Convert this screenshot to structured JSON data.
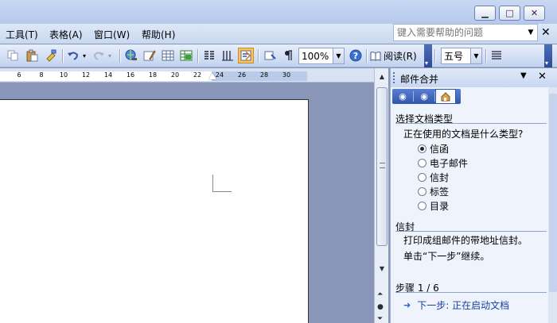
{
  "window": {
    "buttons": [
      "minimize",
      "maximize",
      "close"
    ]
  },
  "menubar": {
    "items": [
      "工具(T)",
      "表格(A)",
      "窗口(W)",
      "帮助(H)"
    ],
    "help_placeholder": "键入需要帮助的问题"
  },
  "toolbar": {
    "zoom_value": "100%",
    "read_label": "阅读(R)",
    "font_size_value": "五号"
  },
  "ruler": {
    "ticks": [
      "6",
      "8",
      "10",
      "12",
      "14",
      "16",
      "18",
      "20",
      "22",
      "24",
      "26",
      "28",
      "30"
    ]
  },
  "taskpane": {
    "title": "邮件合并",
    "section1_title": "选择文档类型",
    "question": "正在使用的文档是什么类型?",
    "options": [
      {
        "label": "信函",
        "selected": true
      },
      {
        "label": "电子邮件",
        "selected": false
      },
      {
        "label": "信封",
        "selected": false
      },
      {
        "label": "标签",
        "selected": false
      },
      {
        "label": "目录",
        "selected": false
      }
    ],
    "section2_title": "信封",
    "description": "打印成组邮件的带地址信封。",
    "hint": "单击“下一步”继续。",
    "step_label": "步骤 1 / 6",
    "next_link": "下一步: 正在启动文档"
  },
  "colors": {
    "accent": "#2f56ab",
    "active_button": "#ffc25a",
    "pane_bg": "#eef3fc"
  }
}
